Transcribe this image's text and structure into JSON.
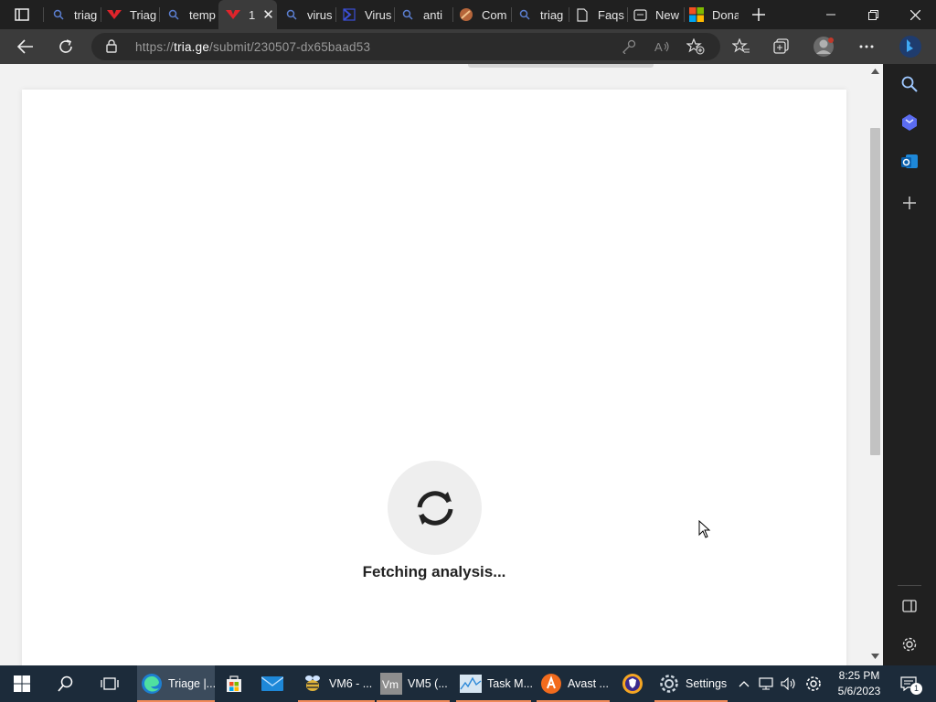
{
  "tabs": [
    {
      "title": "triage",
      "favicon": "search-icon"
    },
    {
      "title": "Triage",
      "favicon": "triage-logo-icon"
    },
    {
      "title": "temp",
      "favicon": "search-icon"
    },
    {
      "title": "1",
      "favicon": "triage-logo-icon",
      "active": true
    },
    {
      "title": "virus",
      "favicon": "search-icon"
    },
    {
      "title": "Virus",
      "favicon": "virustotal-icon"
    },
    {
      "title": "anti",
      "favicon": "search-icon"
    },
    {
      "title": "Com",
      "favicon": "orange-circle-icon"
    },
    {
      "title": "triag",
      "favicon": "search-icon"
    },
    {
      "title": "Faqs",
      "favicon": "page-icon"
    },
    {
      "title": "New",
      "favicon": "new-tab-icon"
    },
    {
      "title": "Dona",
      "favicon": "microsoft-logo-icon"
    }
  ],
  "address": {
    "scheme": "https://",
    "domain": "tria.ge",
    "path": "/submit/230507-dx65baad53"
  },
  "content": {
    "status_text": "Fetching analysis..."
  },
  "taskbar": {
    "items": [
      {
        "label": "Triage |...",
        "icon": "edge-icon"
      },
      {
        "label": "",
        "icon": "store-icon"
      },
      {
        "label": "",
        "icon": "mail-icon"
      },
      {
        "label": "VM6 - ...",
        "icon": "vm-bee-icon"
      },
      {
        "label": "VM5 (...",
        "icon": "vmware-icon"
      },
      {
        "label": "Task M...",
        "icon": "task-manager-icon"
      },
      {
        "label": "Avast ...",
        "icon": "avast-icon"
      },
      {
        "label": "",
        "icon": "shield-badge-icon"
      },
      {
        "label": "Settings",
        "icon": "gear-icon"
      }
    ],
    "clock": {
      "time": "8:25 PM",
      "date": "5/6/2023"
    },
    "notification_count": "1"
  },
  "colors": {
    "brand_red": "#e0242b",
    "accent_blue": "#2b88d8",
    "taskbar_bg": "#1c2b3a",
    "running_indicator": "#f08a5a"
  }
}
